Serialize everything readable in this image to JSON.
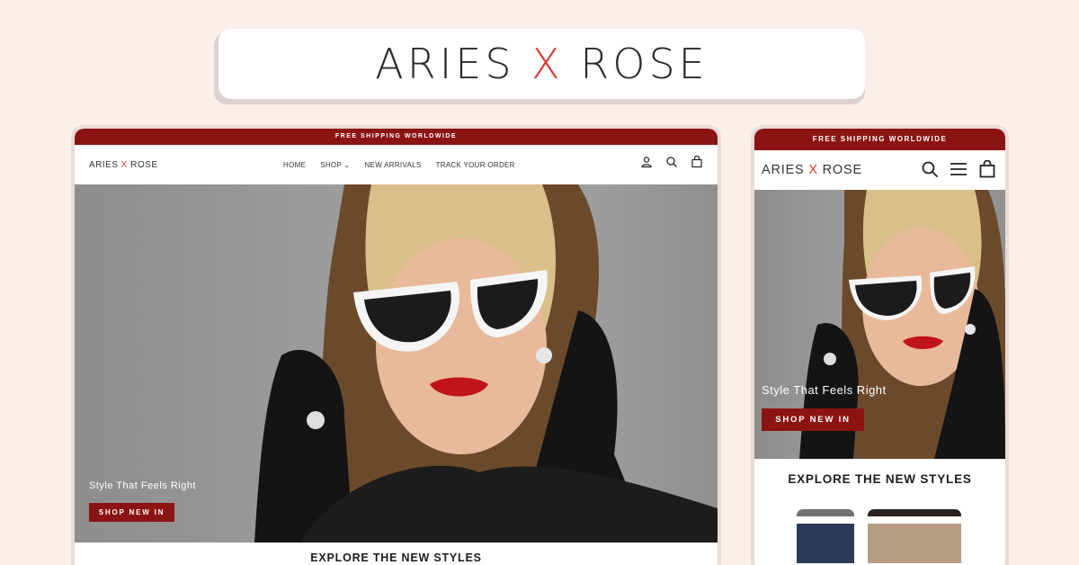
{
  "brand": {
    "name_left": "ARIES ",
    "name_x": "X",
    "name_right": " ROSE"
  },
  "colors": {
    "accent": "#8b1412",
    "logo_x": "#d8392f",
    "background": "#fbefec"
  },
  "desktop": {
    "shipping_bar": "FREE SHIPPING WORLDWIDE",
    "logo_left": "ARIES ",
    "logo_x": "X",
    "logo_right": " ROSE",
    "nav": {
      "home": "HOME",
      "shop": "SHOP",
      "new_arrivals": "NEW ARRIVALS",
      "track_order": "TRACK YOUR ORDER"
    },
    "icons": [
      "account-icon",
      "search-icon",
      "cart-icon"
    ],
    "hero": {
      "tagline": "Style That Feels Right",
      "cta": "SHOP NEW IN"
    },
    "section_heading": "EXPLORE THE NEW STYLES"
  },
  "mobile": {
    "shipping_bar": "FREE SHIPPING WORLDWIDE",
    "logo_left": "ARIES ",
    "logo_x": "X",
    "logo_right": " ROSE",
    "icons": [
      "search-icon",
      "menu-icon",
      "cart-icon"
    ],
    "hero": {
      "tagline": "Style That Feels Right",
      "cta": "SHOP NEW IN"
    },
    "section_heading": "EXPLORE THE NEW STYLES"
  }
}
